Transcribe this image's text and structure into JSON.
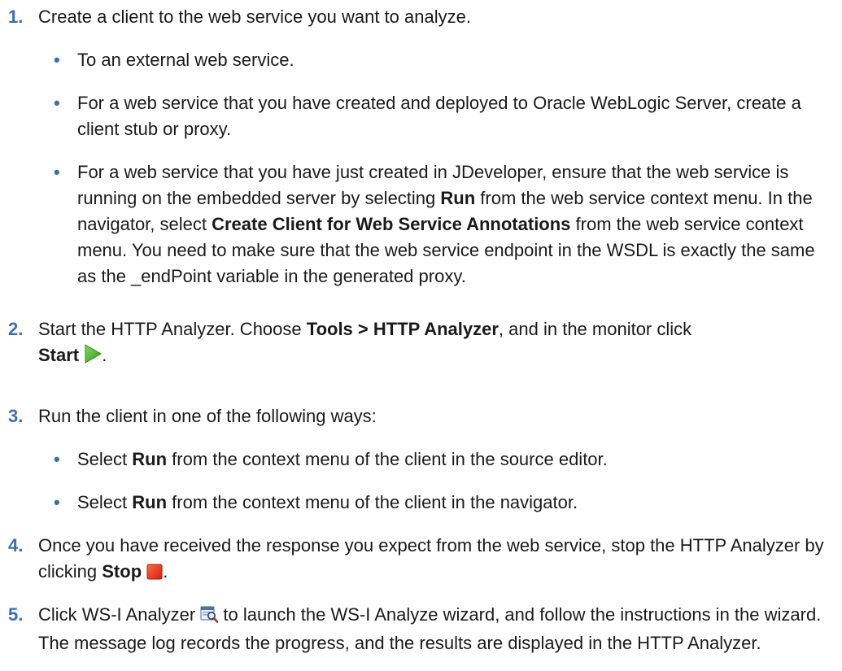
{
  "steps": [
    {
      "num": "1.",
      "text": "Create a client to the web service you want to analyze.",
      "bullets": [
        {
          "text": "To an external web service."
        },
        {
          "text": "For a web service that you have created and deployed to Oracle WebLogic Server, create a client stub or proxy."
        },
        {
          "t1": "For a web service that you have just created in JDeveloper, ensure that the web service is running on the embedded server by selecting ",
          "b1": "Run",
          "t2": " from the web service context menu. In the navigator, select ",
          "b2": "Create Client for Web Service Annotations",
          "t3": " from the web service context menu. You need to make sure that the web service endpoint in the WSDL is exactly the same as the _endPoint variable in the generated proxy."
        }
      ]
    },
    {
      "num": "2.",
      "t1": "Start the HTTP Analyzer. Choose ",
      "b1": "Tools > HTTP Analyzer",
      "t2": ", and in the monitor click ",
      "b2": "Start",
      "t3": "."
    },
    {
      "num": "3.",
      "text": "Run the client in one of the following ways:",
      "bullets": [
        {
          "t1": "Select ",
          "b1": "Run",
          "t2": " from the context menu of the client in the source editor."
        },
        {
          "t1": "Select ",
          "b1": "Run",
          "t2": " from the context menu of the client in the navigator."
        }
      ]
    },
    {
      "num": "4.",
      "t1": "Once you have received the response you expect from the web service, stop the HTTP Analyzer by clicking ",
      "b1": "Stop",
      "t2": "."
    },
    {
      "num": "5.",
      "t1": "Click WS-I Analyzer ",
      "t2": " to launch the WS-I Analyze wizard, and follow the instructions in the wizard. The message log records the progress, and the results are displayed in the HTTP Analyzer."
    }
  ],
  "bullet_char": "•",
  "icons": [
    "start-play-icon",
    "stop-square-icon",
    "ws-i-analyzer-icon"
  ],
  "colors": {
    "accent": "#3d6eb0",
    "text": "#1a1a1a",
    "start_icon": "#3fae2a",
    "stop_icon": "#e03018"
  }
}
